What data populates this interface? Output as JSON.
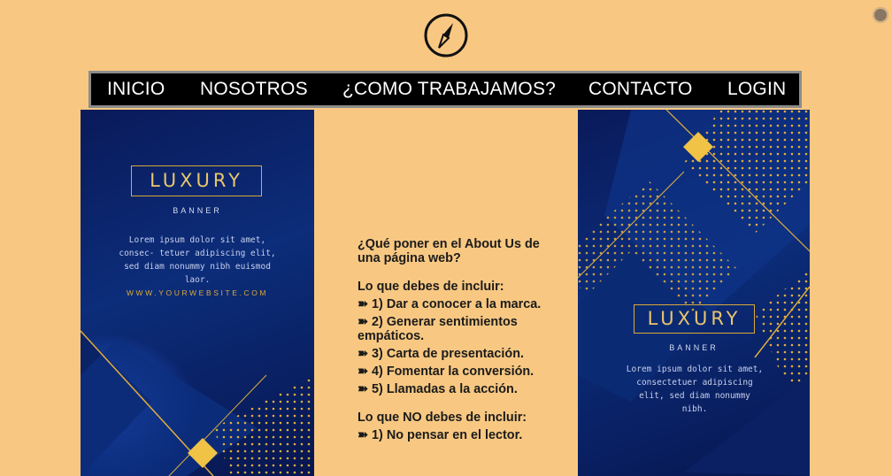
{
  "header": {
    "logo_icon": "compass-icon"
  },
  "nav": {
    "items": [
      "INICIO",
      "NOSOTROS",
      "¿COMO TRABAJAMOS?",
      "CONTACTO",
      "LOGIN"
    ]
  },
  "banner_left": {
    "title": "LUXURY",
    "subtitle": "BANNER",
    "body": "Lorem ipsum dolor sit amet, consec- tetuer adipiscing elit, sed diam nonummy nibh euismod laor.",
    "website": "WWW.YOURWEBSITE.COM"
  },
  "banner_right": {
    "title": "LUXURY",
    "subtitle": "BANNER",
    "body": "Lorem ipsum dolor sit amet, consectetuer adipiscing elit, sed diam nonummy nibh."
  },
  "article": {
    "question": "¿Qué poner en el About Us de una página web?",
    "include_heading": "Lo que debes de incluir:",
    "include_items": [
      "➽ 1) Dar a conocer a la marca.",
      "➽ 2) Generar sentimientos empáticos.",
      "➽ 3) Carta de presentación.",
      "➽ 4) Fomentar la conversión.",
      "➽ 5) Llamadas a la acción."
    ],
    "exclude_heading": "Lo que NO debes de incluir:",
    "exclude_items": [
      "➽ 1) No pensar en el lector."
    ]
  },
  "colors": {
    "page_bg": "#f8c882",
    "nav_bg": "#000000",
    "banner_navy": "#0c2d7a",
    "gold": "#d9a93a"
  }
}
